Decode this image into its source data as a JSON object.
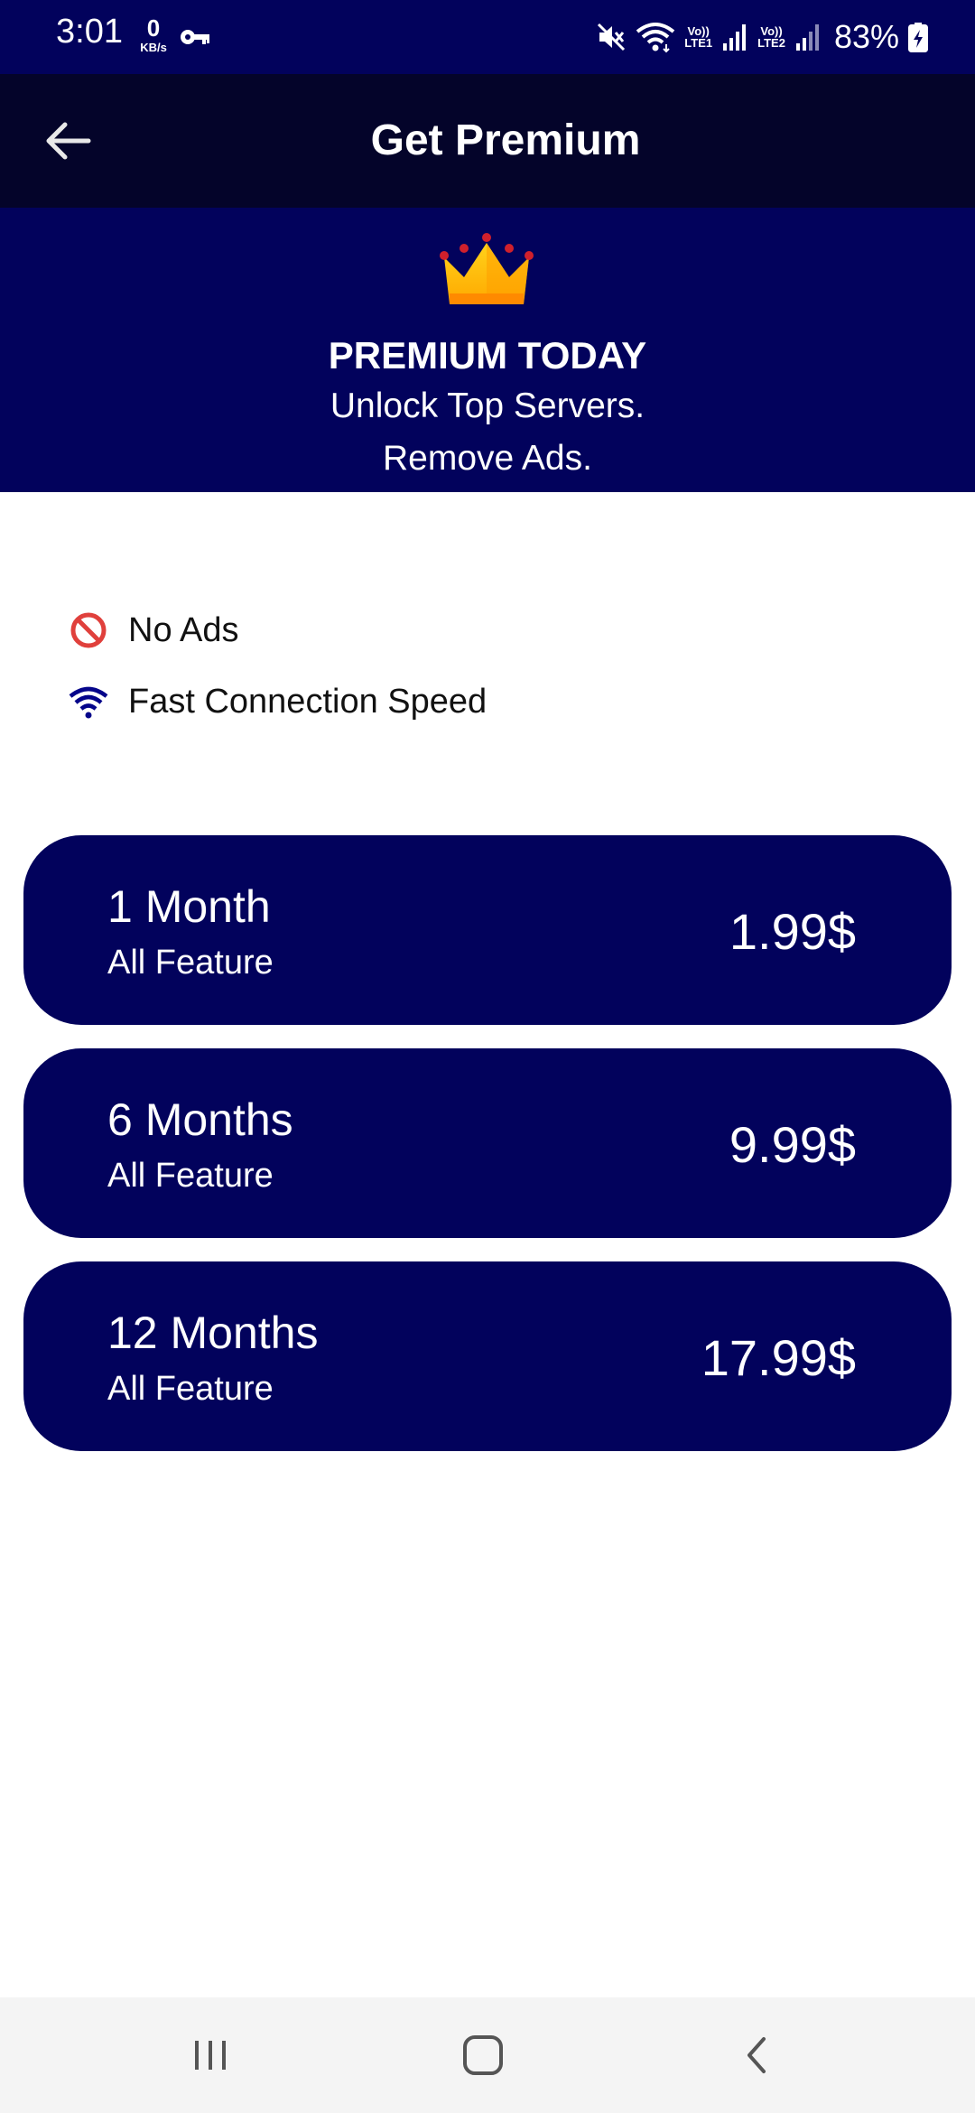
{
  "status_bar": {
    "time": "3:01",
    "data_rate_value": "0",
    "data_rate_unit": "KB/s",
    "sim1_label_top": "Vo))",
    "sim1_label_bottom": "LTE1",
    "sim2_label_top": "Vo))",
    "sim2_label_bottom": "LTE2",
    "battery_percent": "83%",
    "icons": [
      "vpn-key-icon",
      "mute-icon",
      "wifi-icon",
      "signal-icon",
      "battery-charging-icon"
    ]
  },
  "app_bar": {
    "title": "Get Premium",
    "back_icon": "arrow-left-icon"
  },
  "hero": {
    "icon": "crown-icon",
    "title": "PREMIUM TODAY",
    "line1": "Unlock Top Servers.",
    "line2": "Remove Ads.",
    "background_color": "#02025c"
  },
  "features": [
    {
      "icon": "no-ads-icon",
      "label": "No Ads"
    },
    {
      "icon": "wifi-icon",
      "label": "Fast Connection Speed"
    }
  ],
  "plans": [
    {
      "name": "1 Month",
      "subtitle": "All Feature",
      "price": "1.99$"
    },
    {
      "name": "6 Months",
      "subtitle": "All Feature",
      "price": "9.99$"
    },
    {
      "name": "12 Months",
      "subtitle": "All Feature",
      "price": "17.99$"
    }
  ],
  "nav_bar": {
    "buttons": [
      "recents-icon",
      "home-icon",
      "back-icon"
    ]
  },
  "colors": {
    "primary": "#02025c",
    "app_bar": "#04042a",
    "text_on_primary": "#ffffff"
  }
}
